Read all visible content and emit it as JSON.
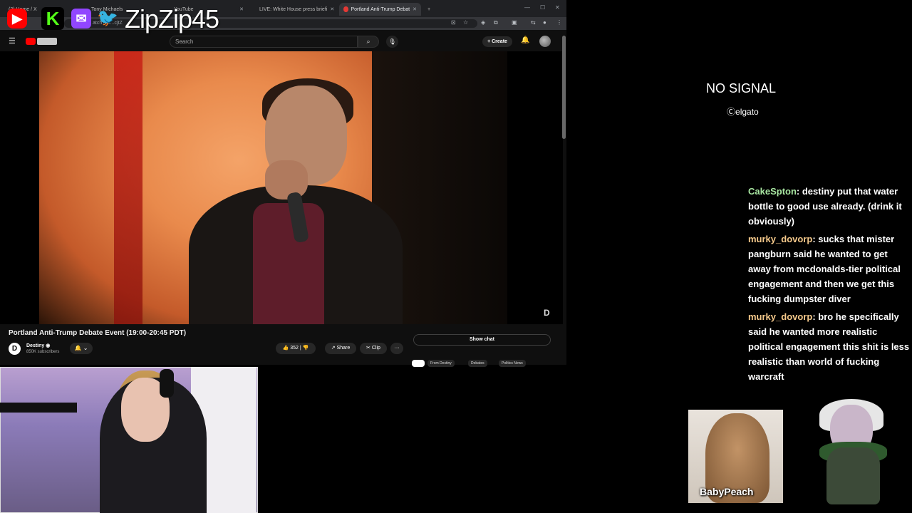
{
  "browser": {
    "tabs": [
      {
        "label": "(3) Home / X",
        "active": false
      },
      {
        "label": "Tony Michaels",
        "active": false
      },
      {
        "label": "YouTube",
        "active": false
      },
      {
        "label": "LIVE: White House press briefi",
        "active": false
      },
      {
        "label": "Portland Anti-Trump Debat",
        "active": true
      }
    ],
    "url_partial": "atch?v=...cjtZ",
    "new_tab": "+"
  },
  "youtube": {
    "search_placeholder": "Search",
    "create_label": "Create",
    "video_title": "Portland Anti-Trump Debate Event (19:00-20:45 PDT)",
    "channel_name": "Destiny",
    "channel_logo": "D",
    "subscribers": "850K subscribers",
    "likes": "352",
    "share_label": "Share",
    "clip_label": "Clip",
    "more_label": "···",
    "show_chat_label": "Show chat",
    "chips": [
      "From Destiny",
      "Debates",
      "Politics News"
    ],
    "watermark": "D"
  },
  "overlay": {
    "handle": "ZipZip45",
    "kick_letter": "K",
    "no_signal": "NO SIGNAL",
    "elgato": "elgato",
    "avatar_name": "BabyPeach"
  },
  "chat": [
    {
      "user": "CakeSpton",
      "text": ": destiny put that water bottle to good use already. (drink it obviously)",
      "color": "#a8e6a1"
    },
    {
      "user": "murky_dovorp",
      "text": ": sucks that mister pangburn said he wanted to get away from mcdonalds-tier political engagement and then we get this fucking dumpster diver",
      "color": "#f5c98b"
    },
    {
      "user": "murky_dovorp",
      "text": ": bro he specifically said he wanted more realistic political engagement this shit is less realistic than world of fucking warcraft",
      "color": "#f5c98b"
    }
  ]
}
